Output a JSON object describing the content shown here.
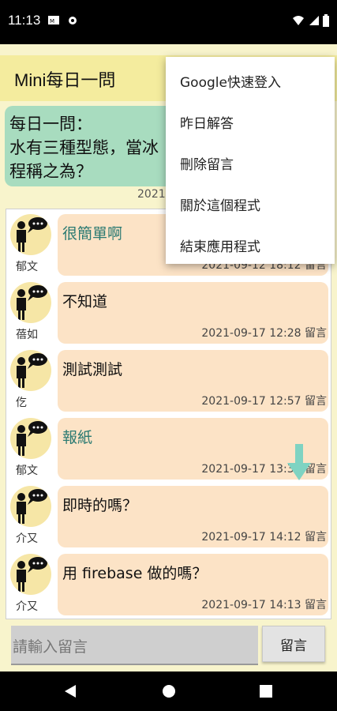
{
  "status": {
    "time": "11:13"
  },
  "app": {
    "title": "Mini每日一問"
  },
  "question": {
    "text": "每日一問：\n水有三種型態，當冰\n程稱之為？",
    "date": "2021"
  },
  "messages": [
    {
      "user": "郁文",
      "text": "很簡單啊",
      "time": "2021-09-12 18:12 留言"
    },
    {
      "user": "蓓如",
      "text": "不知道",
      "time": "2021-09-17 12:28 留言"
    },
    {
      "user": "仡",
      "text": "測試測試",
      "time": "2021-09-17 12:57 留言"
    },
    {
      "user": "郁文",
      "text": "報紙",
      "time": "2021-09-17 13:39 留言"
    },
    {
      "user": "介又",
      "text": "即時的嗎？",
      "time": "2021-09-17 14:12 留言"
    },
    {
      "user": "介又",
      "text": "用 firebase 做的嗎？",
      "time": "2021-09-17 14:13 留言"
    }
  ],
  "input": {
    "placeholder": "請輸入留言"
  },
  "send_label": "留言",
  "menu": {
    "items": [
      "Google快速登入",
      "昨日解答",
      "刪除留言",
      "關於這個程式",
      "結束應用程式"
    ]
  },
  "colors": {
    "appbar": "#f4ec9e",
    "question_bg": "#a8dcbf",
    "bubble_bg": "#fce3c6",
    "accent_arrow": "#7fd3c2"
  }
}
